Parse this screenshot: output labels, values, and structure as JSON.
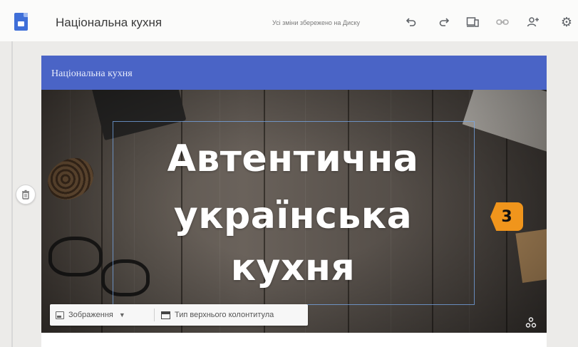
{
  "app": {
    "site_title": "Національна кухня",
    "save_status": "Усі зміни збережено на Диску"
  },
  "toolbar": {
    "icons": [
      "undo-icon",
      "redo-icon",
      "devices-icon",
      "link-icon",
      "share-icon",
      "settings-icon"
    ]
  },
  "page": {
    "header_title": "Національна кухня",
    "hero_title": {
      "line1": "Автентична",
      "line2": "українська",
      "line3": "кухня"
    },
    "badge": "3"
  },
  "hero_toolbar": {
    "image_label": "Зображення",
    "header_type_label": "Тип верхнього колонтитула"
  },
  "colors": {
    "header_band": "#4a64c6",
    "badge": "#f0951c"
  }
}
